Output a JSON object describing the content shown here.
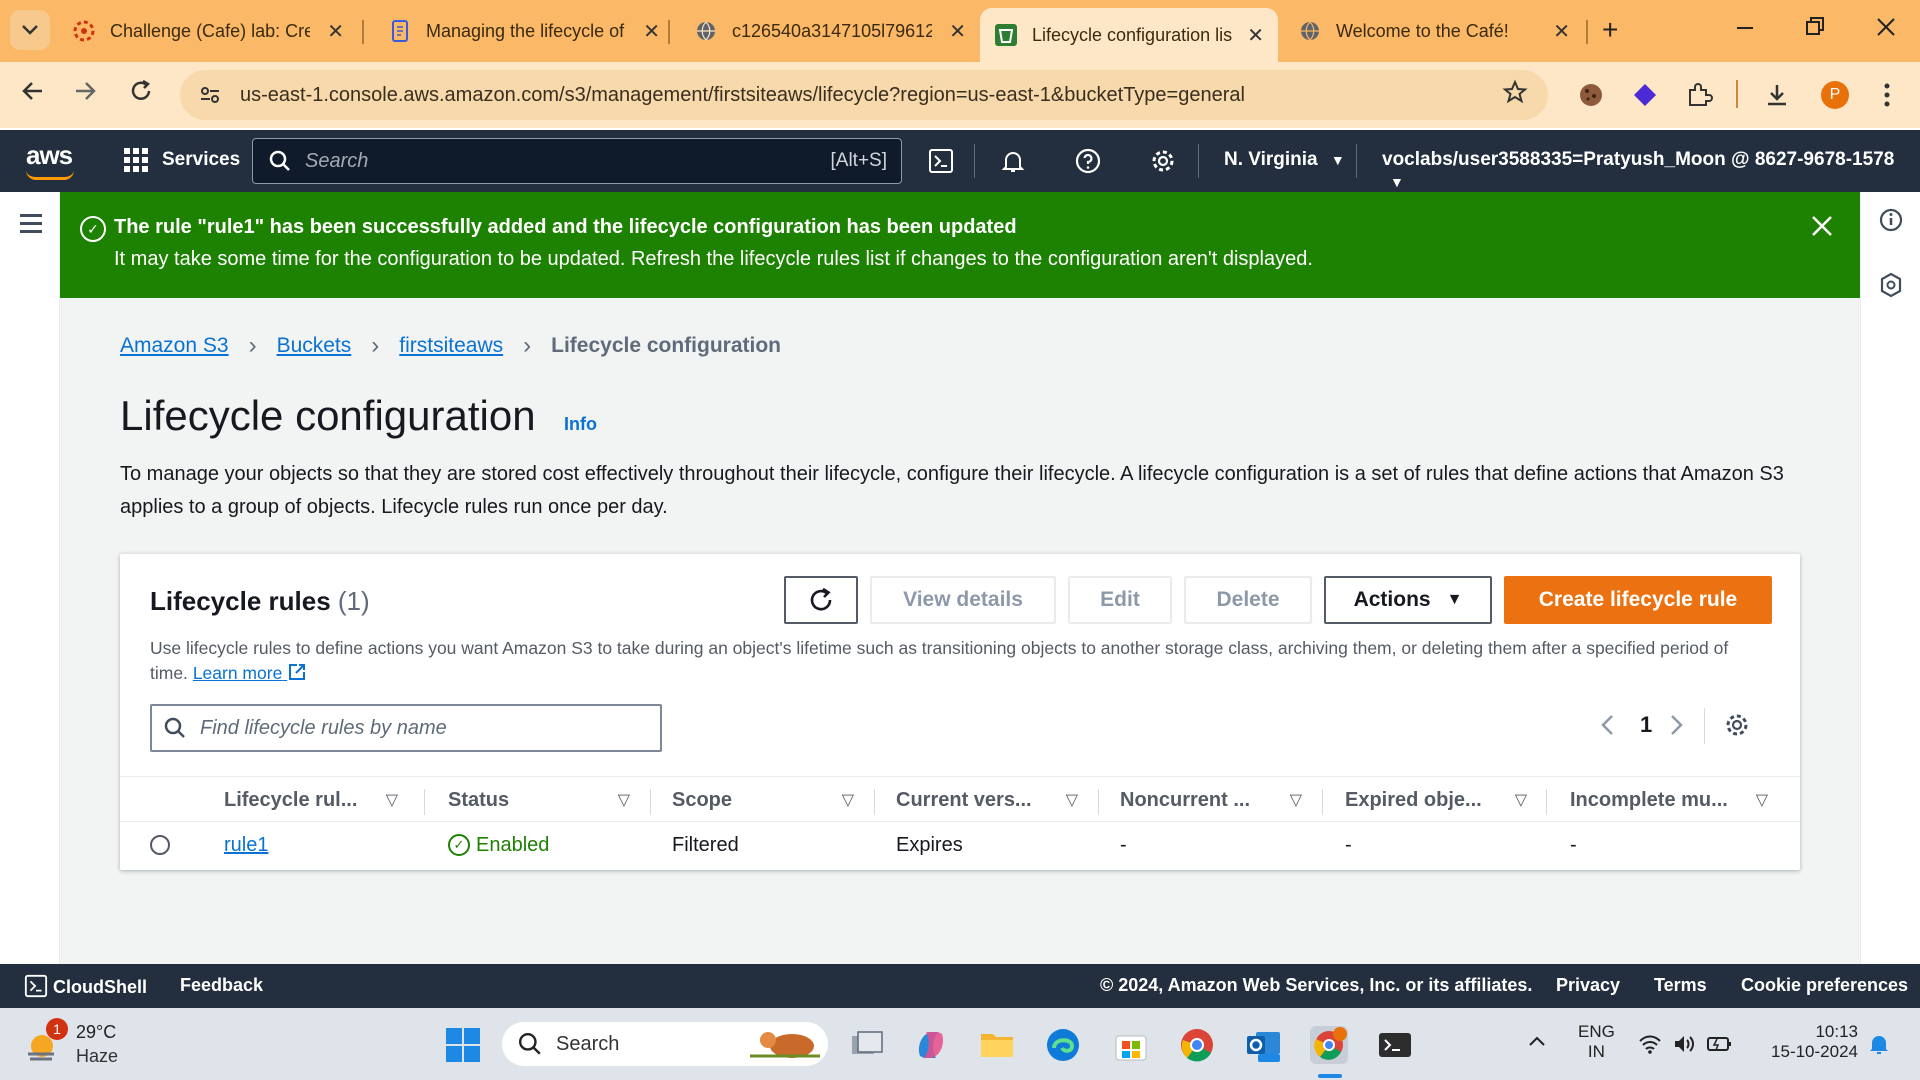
{
  "browser": {
    "tabs": [
      {
        "title": "Challenge (Cafe) lab: Crea",
        "icon": "lab-gear-icon",
        "active": false
      },
      {
        "title": "Managing the lifecycle of",
        "icon": "doc-icon",
        "active": false
      },
      {
        "title": "c126540a3147105l79612",
        "icon": "globe-icon",
        "active": false
      },
      {
        "title": "Lifecycle configuration lis",
        "icon": "s3-bucket-icon",
        "active": true
      },
      {
        "title": "Welcome to the Café!",
        "icon": "globe-icon",
        "active": false
      }
    ],
    "url": "us-east-1.console.aws.amazon.com/s3/management/firstsiteaws/lifecycle?region=us-east-1&bucketType=general",
    "profile_initial": "P",
    "tab_close": "✕",
    "new_tab": "+"
  },
  "awsnav": {
    "logo": "aws",
    "services": "Services",
    "search_placeholder": "Search",
    "search_shortcut": "[Alt+S]",
    "region": "N. Virginia",
    "account": "voclabs/user3588335=Pratyush_Moon @ 8627-9678-1578"
  },
  "flash": {
    "title": "The rule \"rule1\" has been successfully added and the lifecycle configuration has been updated",
    "message": "It may take some time for the configuration to be updated. Refresh the lifecycle rules list if changes to the configuration aren't displayed.",
    "color": "#1d8102"
  },
  "breadcrumb": {
    "items": [
      "Amazon S3",
      "Buckets",
      "firstsiteaws"
    ],
    "current": "Lifecycle configuration"
  },
  "page": {
    "title": "Lifecycle configuration",
    "info": "Info",
    "description": "To manage your objects so that they are stored cost effectively throughout their lifecycle, configure their lifecycle. A lifecycle configuration is a set of rules that define actions that Amazon S3 applies to a group of objects. Lifecycle rules run once per day."
  },
  "rules": {
    "title": "Lifecycle rules",
    "count": "(1)",
    "buttons": {
      "view_details": "View details",
      "edit": "Edit",
      "delete": "Delete",
      "actions": "Actions",
      "create": "Create lifecycle rule"
    },
    "description": "Use lifecycle rules to define actions you want Amazon S3 to take during an object's lifetime such as transitioning objects to another storage class, archiving them, or deleting them after a specified period of time.",
    "learn_more": "Learn more",
    "filter_placeholder": "Find lifecycle rules by name",
    "page_number": "1",
    "columns": [
      "Lifecycle rul...",
      "Status",
      "Scope",
      "Current vers...",
      "Noncurrent ...",
      "Expired obje...",
      "Incomplete mu..."
    ],
    "rows": [
      {
        "name": "rule1",
        "status": "Enabled",
        "scope": "Filtered",
        "current": "Expires",
        "noncurrent": "-",
        "expired": "-",
        "incomplete": "-"
      }
    ]
  },
  "footer": {
    "cloudshell": "CloudShell",
    "feedback": "Feedback",
    "copyright": "© 2024, Amazon Web Services, Inc. or its affiliates.",
    "privacy": "Privacy",
    "terms": "Terms",
    "cookie": "Cookie preferences"
  },
  "taskbar": {
    "temperature": "29°C",
    "weather": "Haze",
    "weather_badge": "1",
    "search_placeholder": "Search",
    "language": "ENG",
    "region": "IN",
    "time": "10:13",
    "date": "15-10-2024"
  }
}
